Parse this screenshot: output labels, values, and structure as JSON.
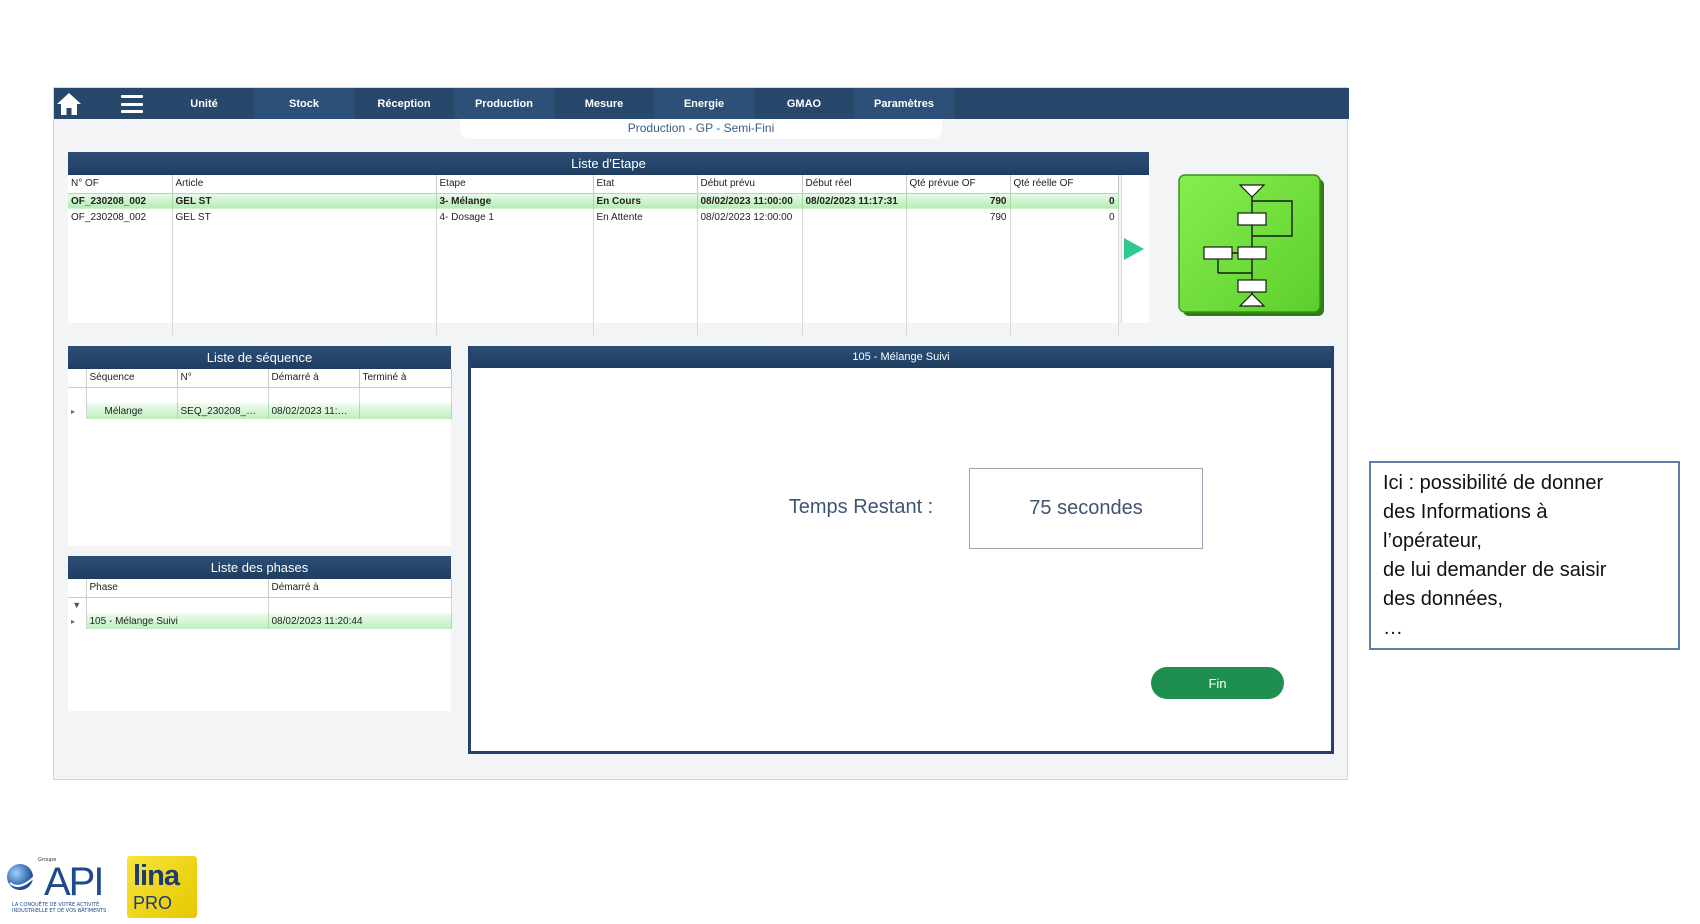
{
  "nav": {
    "items": [
      "Unité",
      "Stock",
      "Réception",
      "Production",
      "Mesure",
      "Energie",
      "GMAO",
      "Paramètres"
    ]
  },
  "page_title": "Production - GP - Semi-Fini",
  "etape": {
    "title": "Liste d'Etape",
    "columns": [
      "N° OF",
      "Article",
      "Etape",
      "Etat",
      "Début prévu",
      "Début réel",
      "Qté prévue OF",
      "Qté réelle OF"
    ],
    "rows": [
      [
        "OF_230208_002",
        "GEL ST",
        "3- Mélange",
        "En Cours",
        "08/02/2023 11:00:00",
        "08/02/2023 11:17:31",
        "790",
        "0"
      ],
      [
        "OF_230208_002",
        "GEL ST",
        "4- Dosage 1",
        "En Attente",
        "08/02/2023 12:00:00",
        "",
        "790",
        "0"
      ]
    ]
  },
  "sequence": {
    "title": "Liste de séquence",
    "columns": [
      "Séquence",
      "N°",
      "Démarré à",
      "Terminé à"
    ],
    "rows": [
      [
        "Mélange",
        "SEQ_230208_…",
        "08/02/2023 11:…",
        ""
      ]
    ]
  },
  "phases": {
    "title": "Liste des phases",
    "columns": [
      "Phase",
      "Démarré à"
    ],
    "rows": [
      [
        "105 - Mélange Suivi",
        "08/02/2023 11:20:44"
      ]
    ]
  },
  "suivi": {
    "title": "105 - Mélange Suivi",
    "label": "Temps Restant :",
    "value": "75 secondes",
    "button": "Fin"
  },
  "callout": {
    "lines": [
      "Ici : possibilité de donner",
      "des Informations à",
      "l’opérateur,",
      "de lui demander de saisir",
      "des données,",
      "…"
    ]
  },
  "logos": {
    "api_small": "Groupe",
    "api": "API",
    "api_tagline1": "LA CONQUÊTE DE VOTRE ACTIVITÉ",
    "api_tagline2": "INDUSTRIELLE ET DE VOS BÂTIMENTS",
    "lina": "lina",
    "lina_pro": "PRO"
  },
  "colors": {
    "nav_bg": "#27486b",
    "selected_row": "#b4ecb4",
    "button_green": "#1e8f4f",
    "flow_green": "#6fe03c"
  }
}
